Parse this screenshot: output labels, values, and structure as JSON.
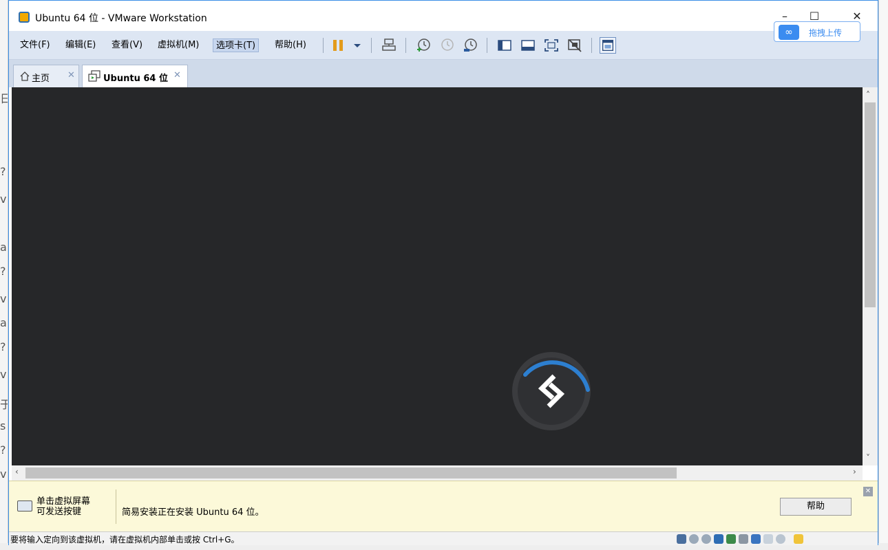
{
  "window": {
    "title": "Ubuntu 64 位 - VMware Workstation",
    "controls": {
      "minimize": "–",
      "maximize": "☐",
      "close": "✕"
    }
  },
  "overlay": {
    "upload_label": "拖拽上传"
  },
  "menu": {
    "items": [
      "文件(F)",
      "编辑(E)",
      "查看(V)",
      "虚拟机(M)",
      "选项卡(T)",
      "帮助(H)"
    ],
    "active": "选项卡(T)"
  },
  "toolbar": {
    "icons": [
      "pause-icon",
      "dropdown-arrow-icon",
      "send-ctrl-alt-del-icon",
      "snapshot-take-icon",
      "snapshot-revert-icon",
      "snapshot-manager-icon",
      "console-view-icon",
      "thumbnail-view-icon",
      "fullscreen-icon",
      "unity-icon",
      "library-icon"
    ]
  },
  "tabs": [
    {
      "label": "主页",
      "close": "✕",
      "active": false
    },
    {
      "label": "Ubuntu 64 位",
      "close": "✕",
      "active": true
    }
  ],
  "infobar": {
    "hint_line1": "单击虚拟屏幕",
    "hint_line2": "可发送按键",
    "message": "简易安装正在安装 Ubuntu 64 位。",
    "help_label": "帮助",
    "close": "✕"
  },
  "statusbar": {
    "text": "要将输入定向到该虚拟机，请在虚拟机内部单击或按 Ctrl+G。"
  },
  "colors": {
    "vm_background": "#262729",
    "menubar": "#dde6f3",
    "tabbar": "#cfdaea",
    "infobar": "#fcf9d9",
    "spinner_accent": "#2d7fd0"
  }
}
